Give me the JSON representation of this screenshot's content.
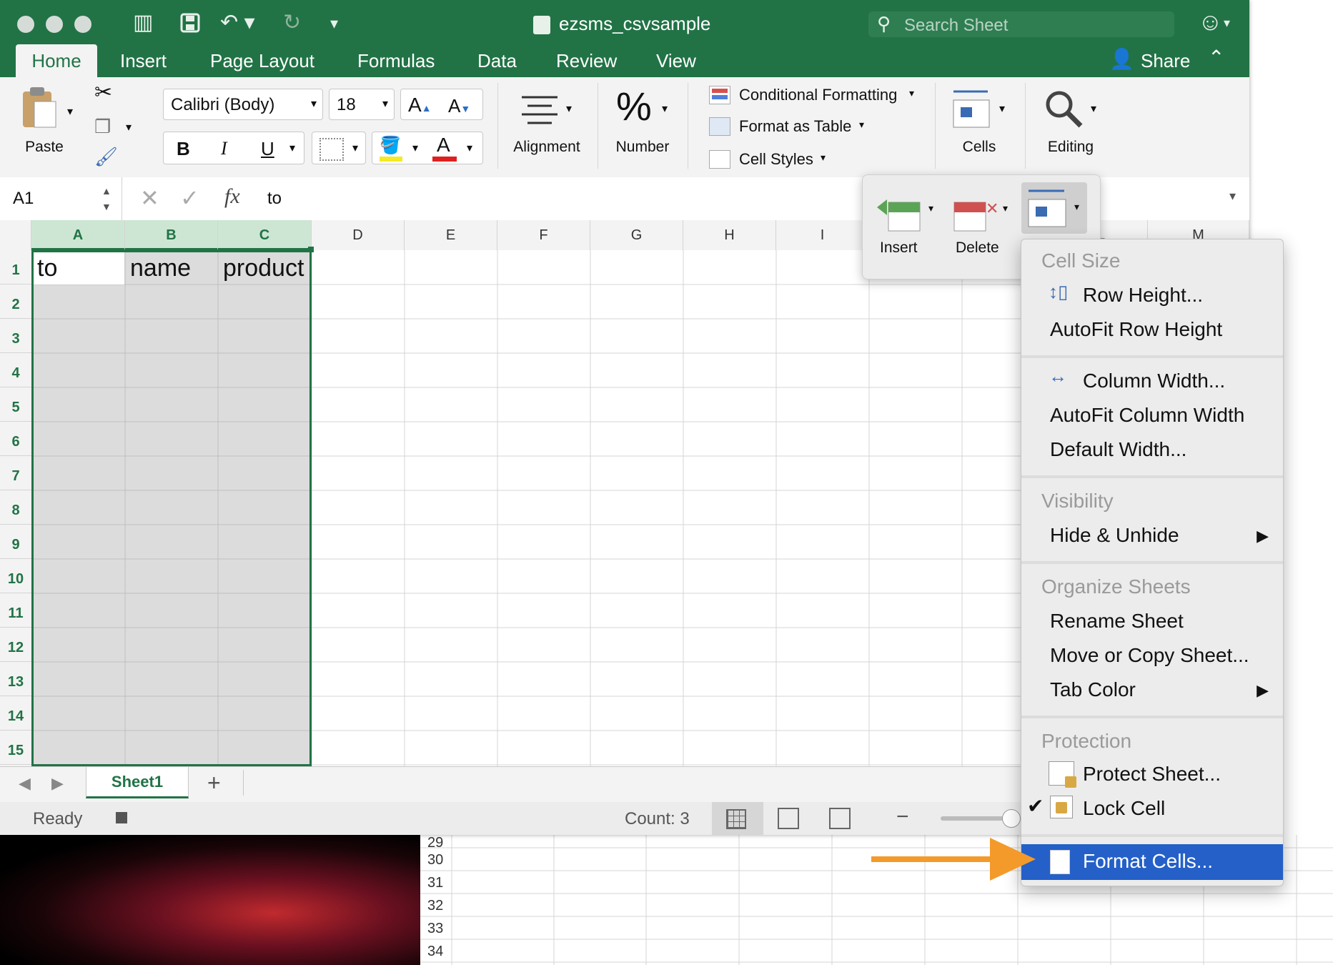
{
  "window": {
    "title": "ezsms_csvsample",
    "search_placeholder": "Search Sheet",
    "share_label": "Share"
  },
  "tabs": [
    "Home",
    "Insert",
    "Page Layout",
    "Formulas",
    "Data",
    "Review",
    "View"
  ],
  "ribbon": {
    "paste_label": "Paste",
    "font_name": "Calibri (Body)",
    "font_size": "18",
    "bold": "B",
    "italic": "I",
    "underline": "U",
    "alignment_label": "Alignment",
    "number_label": "Number",
    "number_icon": "%",
    "conditional_formatting": "Conditional Formatting",
    "format_as_table": "Format as Table",
    "cell_styles": "Cell Styles",
    "cells_label": "Cells",
    "editing_label": "Editing",
    "font_color": "#e02020",
    "highlight_color": "#f5ea2a"
  },
  "formula_bar": {
    "name_box": "A1",
    "fx": "fx",
    "content": "to"
  },
  "grid": {
    "columns": [
      "A",
      "B",
      "C",
      "D",
      "E",
      "F",
      "G",
      "H",
      "I",
      "L",
      "M"
    ],
    "rows": [
      "1",
      "2",
      "3",
      "4",
      "5",
      "6",
      "7",
      "8",
      "9",
      "10",
      "11",
      "12",
      "13",
      "14",
      "15"
    ],
    "row1": [
      "to",
      "name",
      "product"
    ]
  },
  "background_rows": [
    "29",
    "30",
    "31",
    "32",
    "33",
    "34"
  ],
  "sheet_tabs": {
    "active": "Sheet1",
    "add": "+"
  },
  "status": {
    "ready": "Ready",
    "count": "Count: 3"
  },
  "cells_popover": {
    "insert_label": "Insert",
    "delete_label": "Delete"
  },
  "format_menu": {
    "cell_size_header": "Cell Size",
    "row_height": "Row Height...",
    "autofit_row_height": "AutoFit Row Height",
    "column_width": "Column Width...",
    "autofit_column_width": "AutoFit Column Width",
    "default_width": "Default Width...",
    "visibility_header": "Visibility",
    "hide_unhide": "Hide & Unhide",
    "organize_header": "Organize Sheets",
    "rename_sheet": "Rename Sheet",
    "move_copy_sheet": "Move or Copy Sheet...",
    "tab_color": "Tab Color",
    "protection_header": "Protection",
    "protect_sheet": "Protect Sheet...",
    "lock_cell": "Lock Cell",
    "lock_cell_checked": "✔",
    "format_cells": "Format Cells..."
  },
  "colors": {
    "brand_green": "#217346",
    "menu_highlight": "#2460c8",
    "annotation_arrow": "#f39a2b"
  }
}
